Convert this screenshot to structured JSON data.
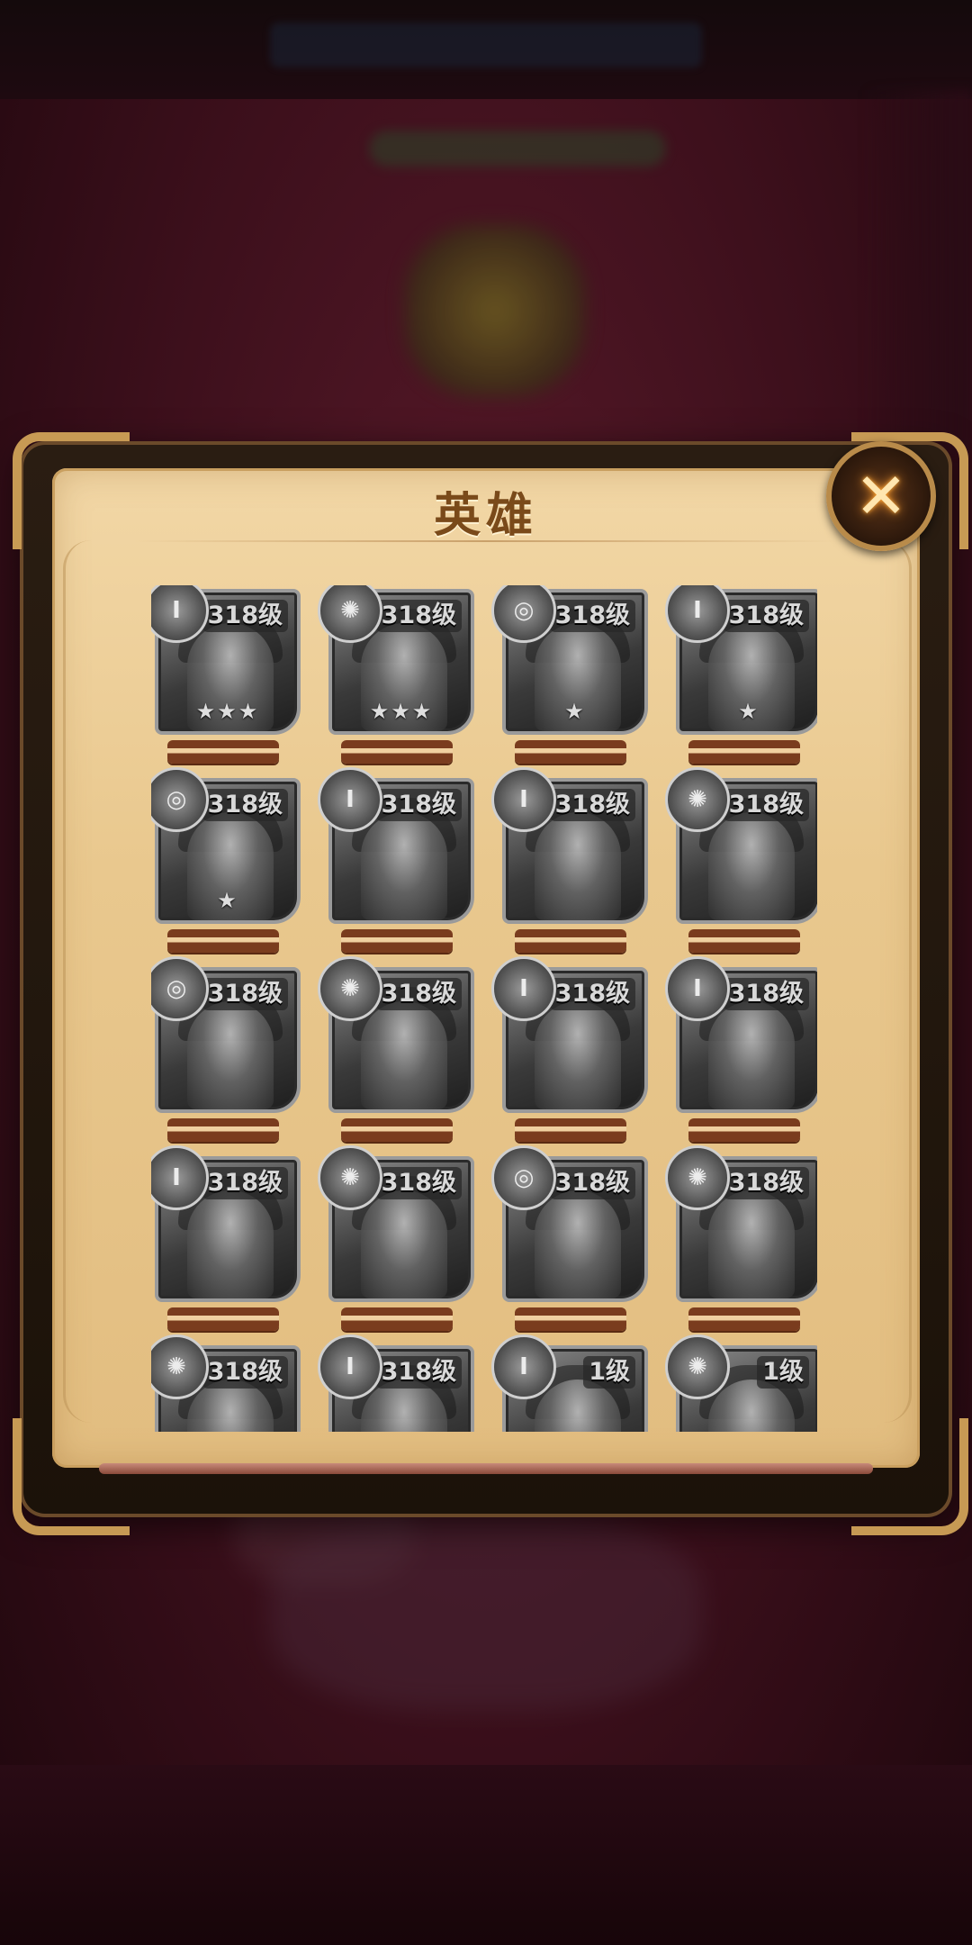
{
  "dialog": {
    "title": "英雄",
    "close_label": "✕"
  },
  "heroes": [
    {
      "level": "318级",
      "stars": "★★★",
      "faction": "I"
    },
    {
      "level": "318级",
      "stars": "★★★",
      "faction": "✺"
    },
    {
      "level": "318级",
      "stars": "★",
      "faction": "◎"
    },
    {
      "level": "318级",
      "stars": "★",
      "faction": "I"
    },
    {
      "level": "318级",
      "stars": "★",
      "faction": "◎"
    },
    {
      "level": "318级",
      "stars": "",
      "faction": "I"
    },
    {
      "level": "318级",
      "stars": "",
      "faction": "I"
    },
    {
      "level": "318级",
      "stars": "",
      "faction": "✺"
    },
    {
      "level": "318级",
      "stars": "",
      "faction": "◎"
    },
    {
      "level": "318级",
      "stars": "",
      "faction": "✺"
    },
    {
      "level": "318级",
      "stars": "",
      "faction": "I"
    },
    {
      "level": "318级",
      "stars": "",
      "faction": "I"
    },
    {
      "level": "318级",
      "stars": "",
      "faction": "I"
    },
    {
      "level": "318级",
      "stars": "",
      "faction": "✺"
    },
    {
      "level": "318级",
      "stars": "",
      "faction": "◎"
    },
    {
      "level": "318级",
      "stars": "",
      "faction": "✺"
    },
    {
      "level": "318级",
      "stars": "",
      "faction": "✺"
    },
    {
      "level": "318级",
      "stars": "",
      "faction": "I"
    },
    {
      "level": "1级",
      "stars": "",
      "faction": "I"
    },
    {
      "level": "1级",
      "stars": "",
      "faction": "✺"
    }
  ]
}
